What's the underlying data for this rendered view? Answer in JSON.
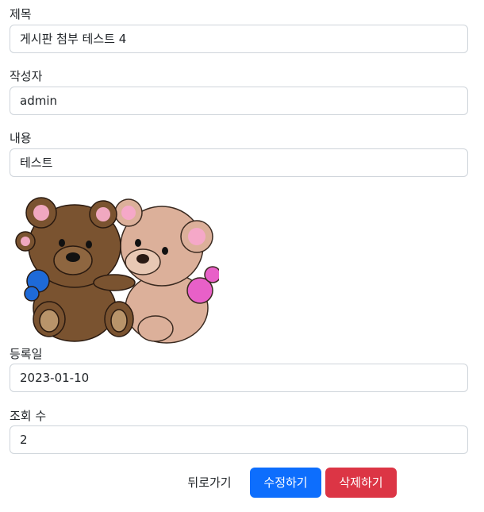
{
  "form": {
    "title_label": "제목",
    "title_value": "게시판 첨부 테스트 4",
    "author_label": "작성자",
    "author_value": "admin",
    "content_label": "내용",
    "content_value": "테스트",
    "attachment_icon": "teddy-bears-image",
    "date_label": "등록일",
    "date_value": "2023-01-10",
    "views_label": "조회 수",
    "views_value": "2"
  },
  "actions": {
    "back_label": "뒤로가기",
    "edit_label": "수정하기",
    "delete_label": "삭제하기"
  },
  "colors": {
    "primary": "#0d6efd",
    "danger": "#dc3545",
    "input_border": "#ced4da"
  }
}
